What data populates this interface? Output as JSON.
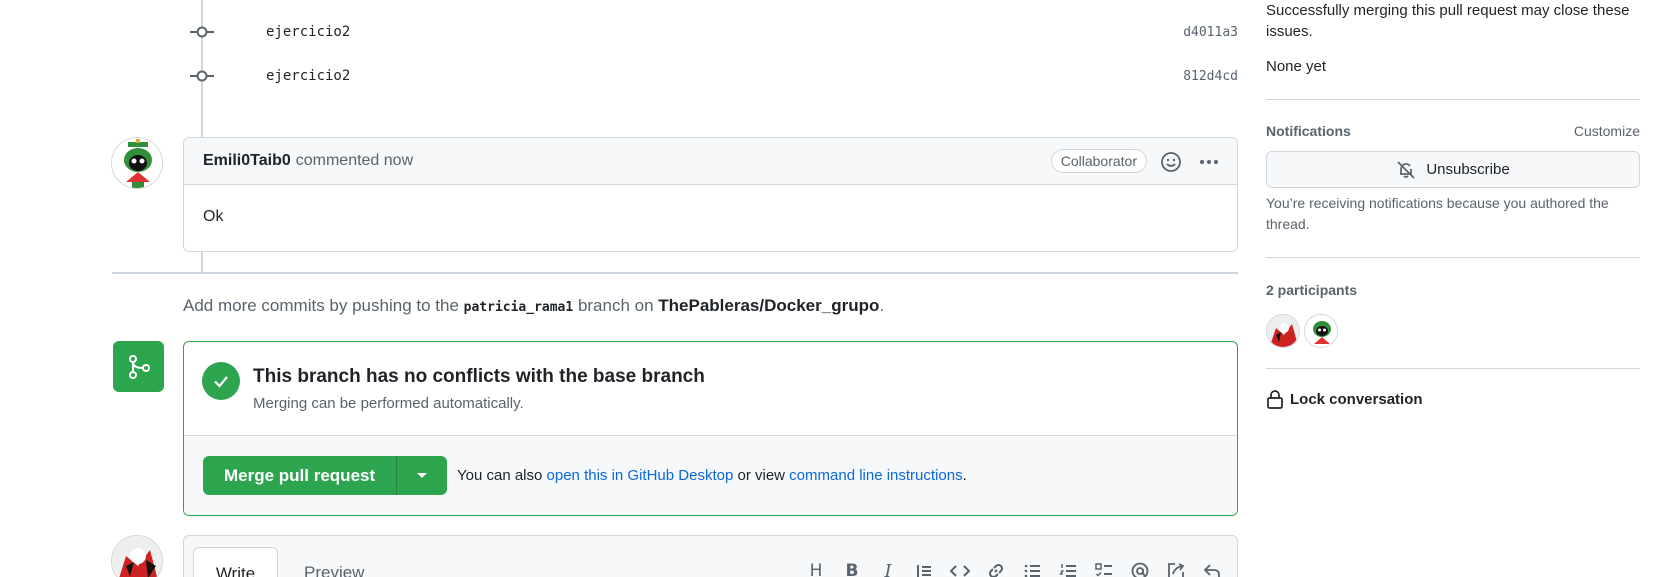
{
  "commits": [
    {
      "message": "ejercicio2",
      "sha": "d4011a3"
    },
    {
      "message": "ejercicio2",
      "sha": "812d4cd"
    }
  ],
  "comment": {
    "author": "Emili0Taib0",
    "meta": "commented now",
    "badge": "Collaborator",
    "body": "Ok"
  },
  "push_hint": {
    "prefix": "Add more commits by pushing to the ",
    "branch": "patricia_rama1",
    "middle": " branch on ",
    "repo": "ThePableras/Docker_grupo",
    "suffix": "."
  },
  "merge": {
    "title": "This branch has no conflicts with the base branch",
    "subtitle": "Merging can be performed automatically.",
    "button": "Merge pull request",
    "alt_prefix": "You can also ",
    "alt_link1": "open this in GitHub Desktop",
    "alt_middle": " or view ",
    "alt_link2": "command line instructions",
    "alt_suffix": "."
  },
  "editor": {
    "tab_write": "Write",
    "tab_preview": "Preview",
    "tools": [
      "heading-icon",
      "bold-icon",
      "italic-icon",
      "quote-icon",
      "code-icon",
      "link-icon",
      "unordered-list-icon",
      "ordered-list-icon",
      "task-list-icon",
      "mention-icon",
      "cross-reference-icon",
      "reply-icon"
    ]
  },
  "sidebar": {
    "issues_text": "Successfully merging this pull request may close these issues.",
    "issues_value": "None yet",
    "notifications_label": "Notifications",
    "customize_label": "Customize",
    "unsubscribe_label": "Unsubscribe",
    "notification_reason": "You’re receiving notifications because you authored the thread.",
    "participants_label": "2 participants",
    "lock_label": "Lock conversation"
  },
  "colors": {
    "success": "#2da44e",
    "link": "#0969da",
    "border": "#d0d7de",
    "muted": "#59636e"
  }
}
